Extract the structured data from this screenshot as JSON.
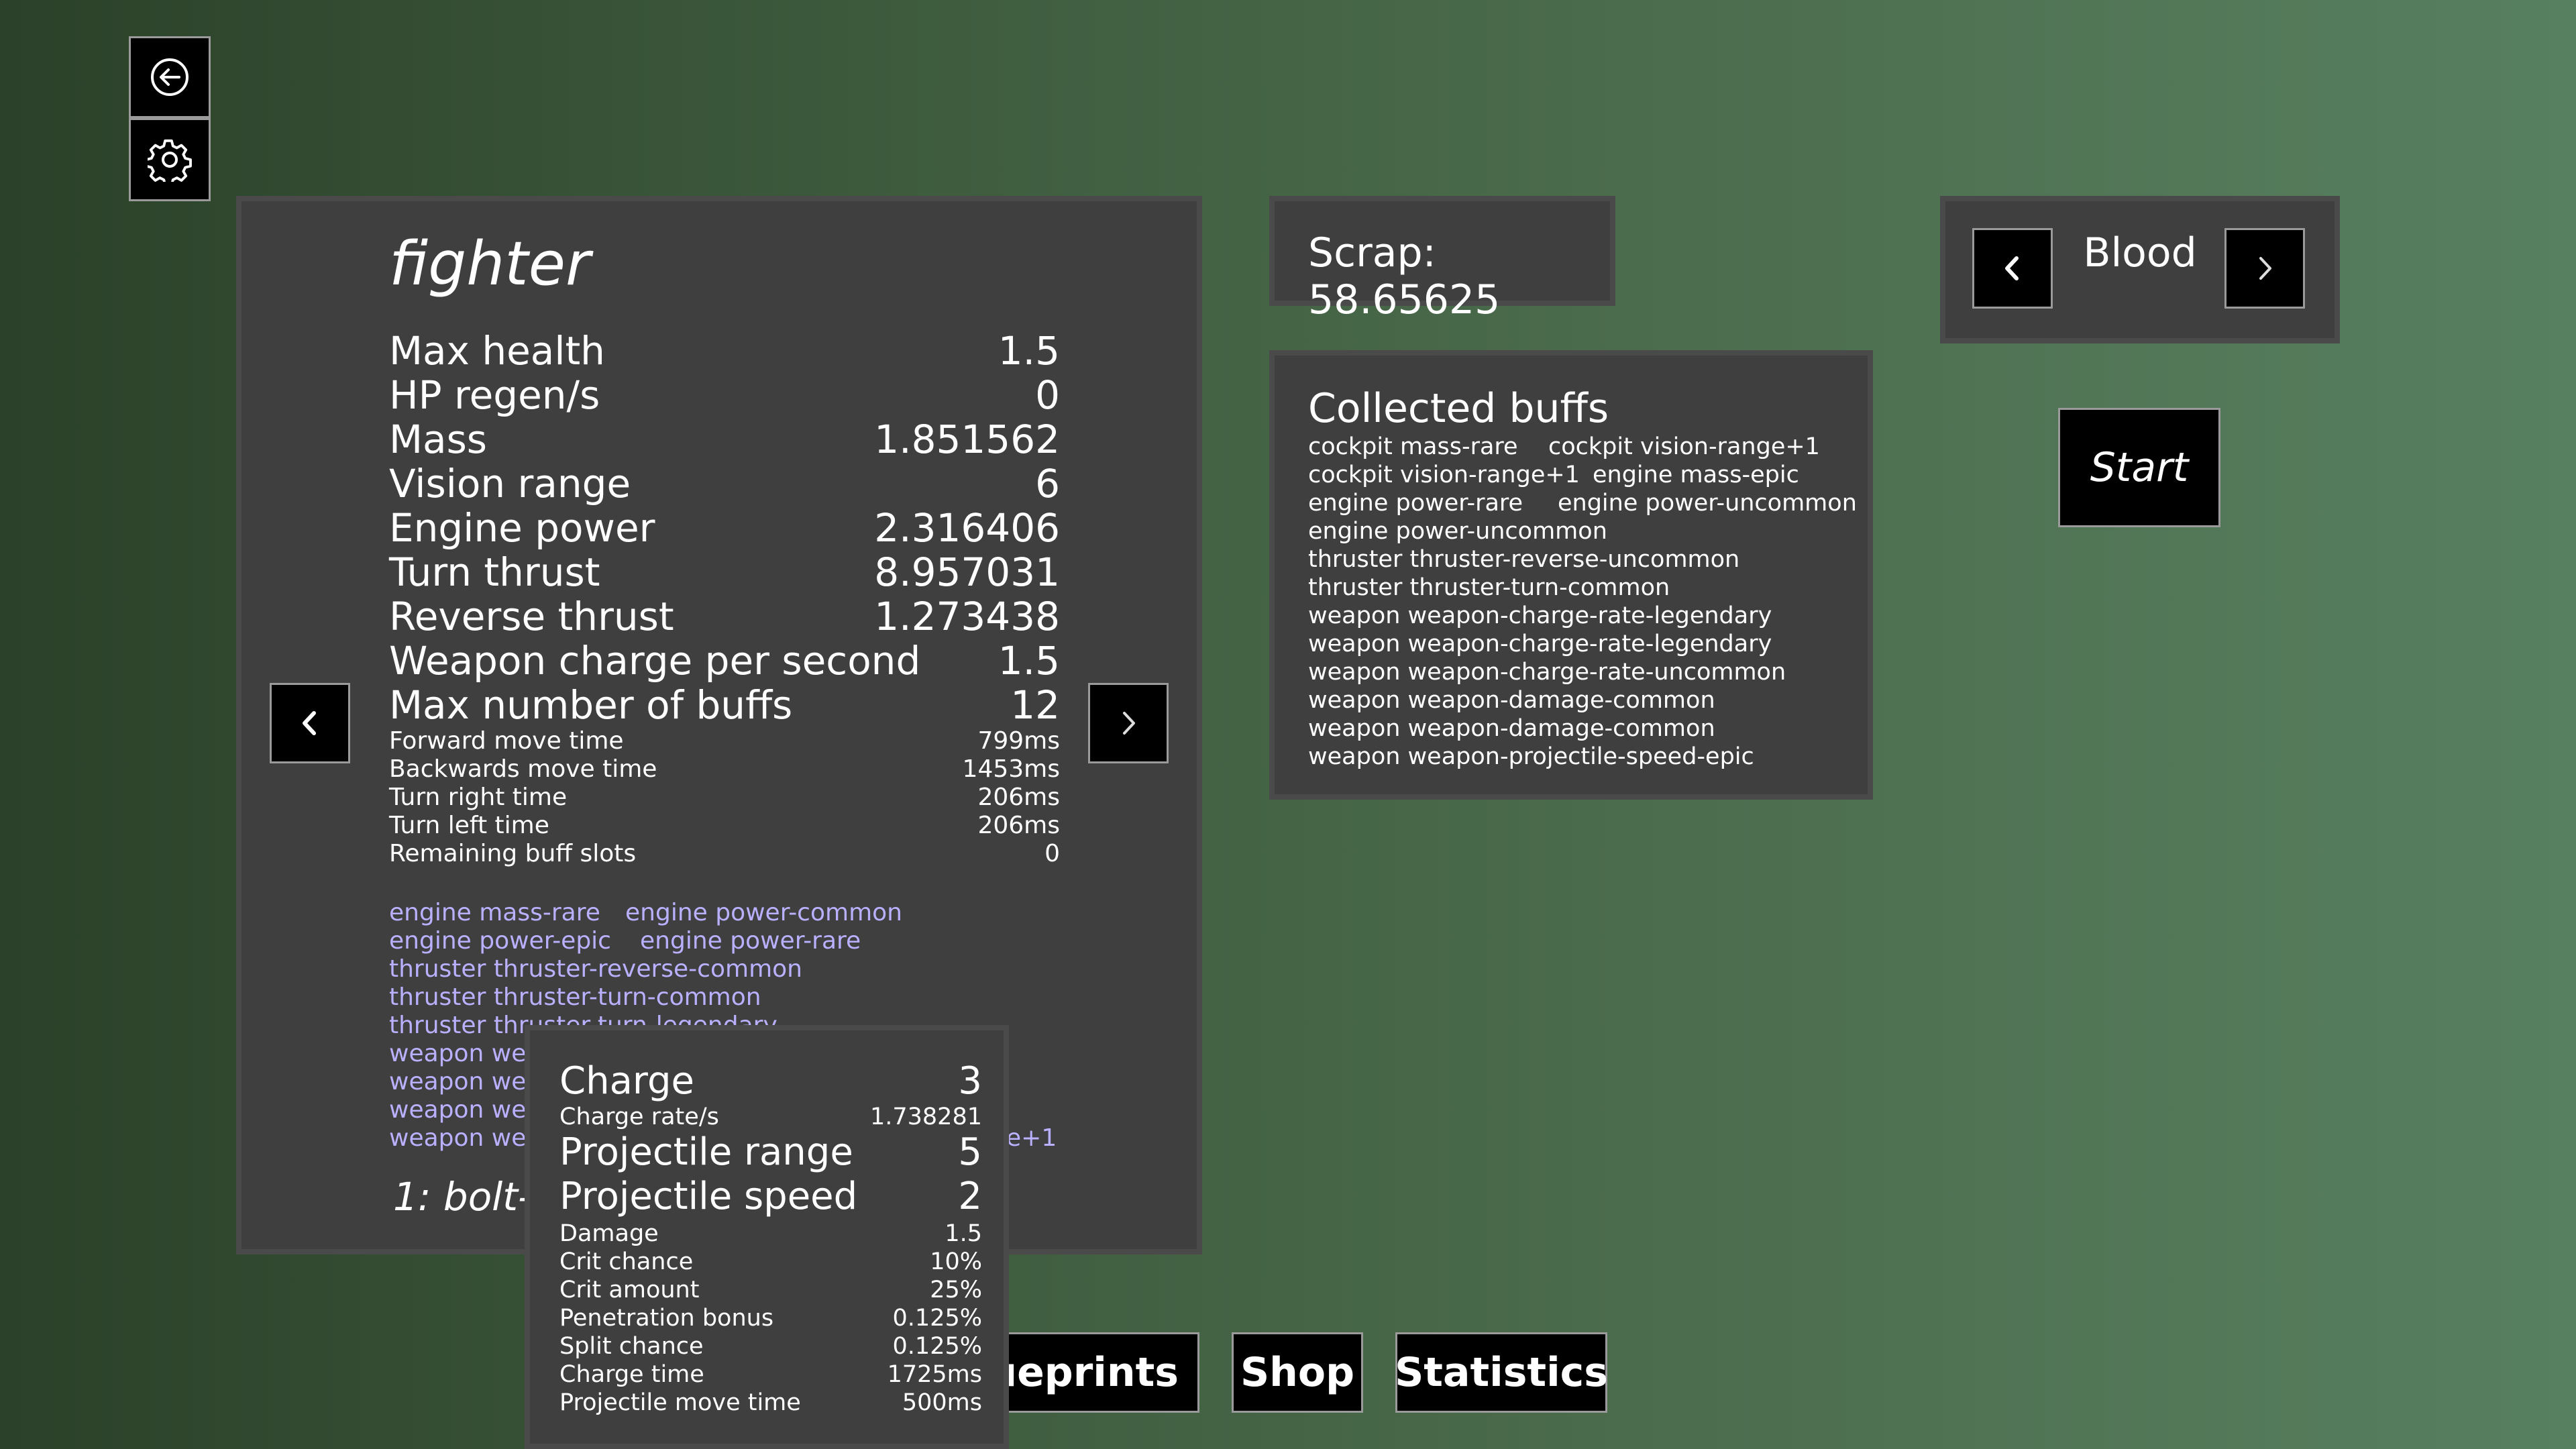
{
  "top_icons": {
    "back_icon": "back-arrow-icon",
    "settings_icon": "gear-icon"
  },
  "ship": {
    "name": "fighter",
    "stats_big": [
      {
        "label": "Max health",
        "value": "1.5"
      },
      {
        "label": "HP regen/s",
        "value": "0"
      },
      {
        "label": "Mass",
        "value": "1.851562"
      },
      {
        "label": "Vision range",
        "value": "6"
      },
      {
        "label": "Engine power",
        "value": "2.316406"
      },
      {
        "label": "Turn thrust",
        "value": "8.957031"
      },
      {
        "label": "Reverse thrust",
        "value": "1.273438"
      },
      {
        "label": "Weapon charge per second",
        "value": "1.5"
      },
      {
        "label": "Max number of buffs",
        "value": "12"
      }
    ],
    "stats_small": [
      {
        "label": "Forward move time",
        "value": "799ms"
      },
      {
        "label": "Backwards move time",
        "value": "1453ms"
      },
      {
        "label": "Turn right time",
        "value": "206ms"
      },
      {
        "label": "Turn left time",
        "value": "206ms"
      },
      {
        "label": "Remaining buff slots",
        "value": "0"
      }
    ],
    "buffs": [
      "engine mass-rare",
      "engine power-common",
      "engine power-epic",
      "engine power-rare",
      "thruster thruster-reverse-common",
      "thruster thruster-turn-common",
      "thruster thruster-turn-legendary",
      "weapon wea",
      "weapon wea",
      "weapon wea",
      "weapon wea",
      "e+1"
    ],
    "weapon_label": "1: bolt-g"
  },
  "weapon_popup": {
    "big": [
      {
        "label": "Charge",
        "value": "3"
      },
      {
        "label": "Projectile range",
        "value": "5"
      },
      {
        "label": "Projectile speed",
        "value": "2"
      }
    ],
    "charge_rate": {
      "label": "Charge rate/s",
      "value": "1.738281"
    },
    "small": [
      {
        "label": "Damage",
        "value": "1.5"
      },
      {
        "label": "Crit chance",
        "value": "10%"
      },
      {
        "label": "Crit amount",
        "value": "25%"
      },
      {
        "label": "Penetration bonus",
        "value": "0.125%"
      },
      {
        "label": "Split chance",
        "value": "0.125%"
      },
      {
        "label": "Charge time",
        "value": "1725ms"
      },
      {
        "label": "Projectile move time",
        "value": "500ms"
      }
    ]
  },
  "scrap": "Scrap: 58.65625",
  "collected_buffs": {
    "title": "Collected buffs",
    "items": [
      "cockpit mass-rare",
      "cockpit vision-range+1",
      "cockpit vision-range+1",
      "engine mass-epic",
      "engine power-rare",
      "engine power-uncommon",
      "engine power-uncommon",
      "thruster thruster-reverse-uncommon",
      "thruster thruster-turn-common",
      "weapon weapon-charge-rate-legendary",
      "weapon weapon-charge-rate-legendary",
      "weapon weapon-charge-rate-uncommon",
      "weapon weapon-damage-common",
      "weapon weapon-damage-common",
      "weapon weapon-projectile-speed-epic"
    ]
  },
  "theme": "Blood",
  "start_label": "Start",
  "bottom_buttons": {
    "blueprints": "lueprints",
    "shop": "Shop",
    "statistics": "Statistics"
  },
  "colors": {
    "buff_link": "#b9b0ff",
    "panel": "#3f3f3f",
    "button": "#000000"
  }
}
